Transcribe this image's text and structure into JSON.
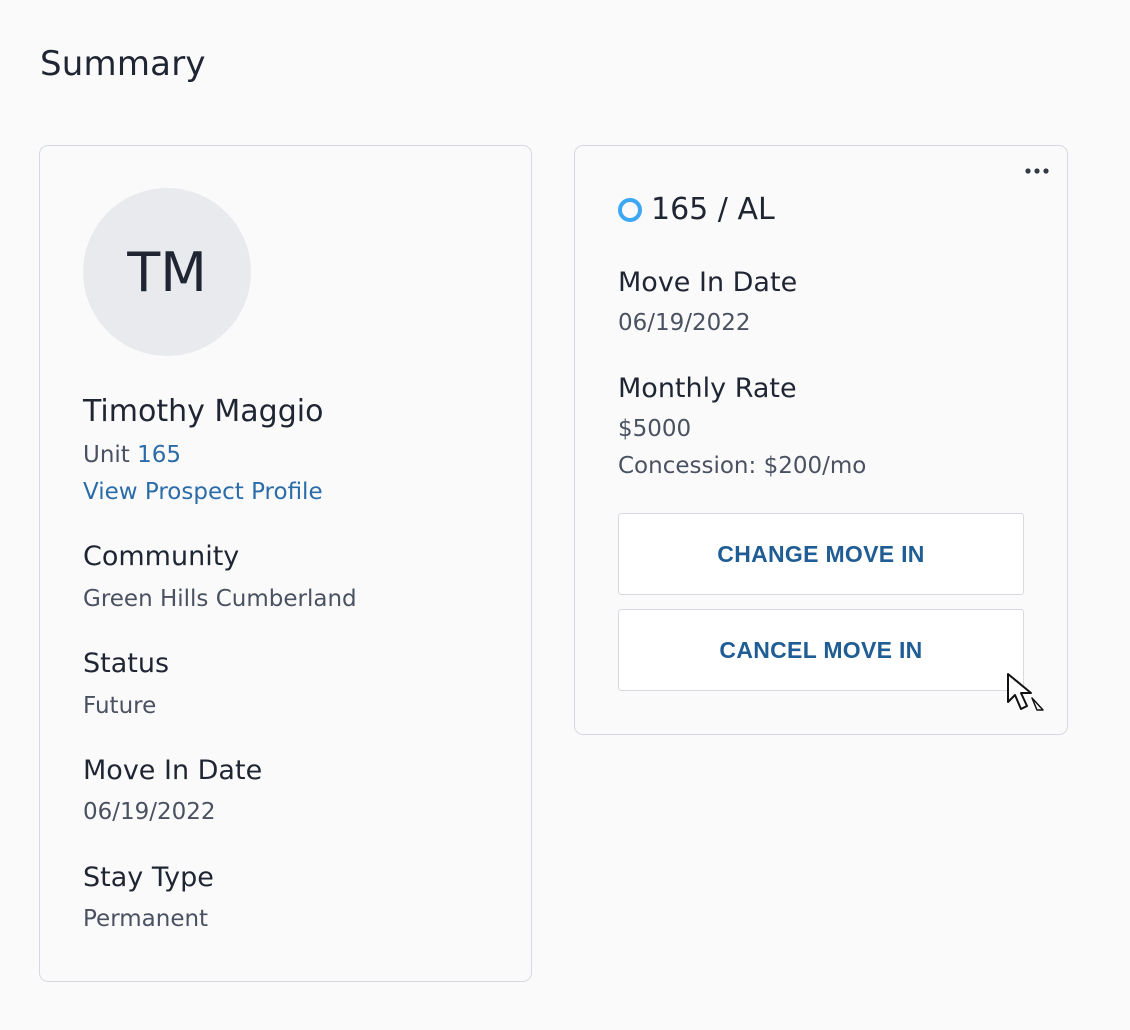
{
  "page": {
    "title": "Summary"
  },
  "resident": {
    "initials": "TM",
    "name": "Timothy Maggio",
    "unit_prefix": "Unit",
    "unit_number": "165",
    "profile_link": "View Prospect Profile",
    "fields": [
      {
        "label": "Community",
        "value": "Green Hills Cumberland"
      },
      {
        "label": "Status",
        "value": "Future"
      },
      {
        "label": "Move In Date",
        "value": "06/19/2022"
      },
      {
        "label": "Stay Type",
        "value": "Permanent"
      }
    ]
  },
  "unit_card": {
    "more_icon": "ellipsis-icon",
    "status_icon": "status-ring-icon",
    "status_color": "#3ca7f5",
    "title": "165 / AL",
    "move_in_label": "Move In Date",
    "move_in_value": "06/19/2022",
    "rate_label": "Monthly Rate",
    "rate_value": "$5000",
    "concession": "Concession: $200/mo",
    "change_button": "CHANGE MOVE IN",
    "cancel_button": "CANCEL MOVE IN"
  },
  "colors": {
    "link": "#2b6ca8",
    "button_text": "#1f5d94",
    "border": "#d6dae0",
    "avatar_bg": "#e8eaee"
  }
}
